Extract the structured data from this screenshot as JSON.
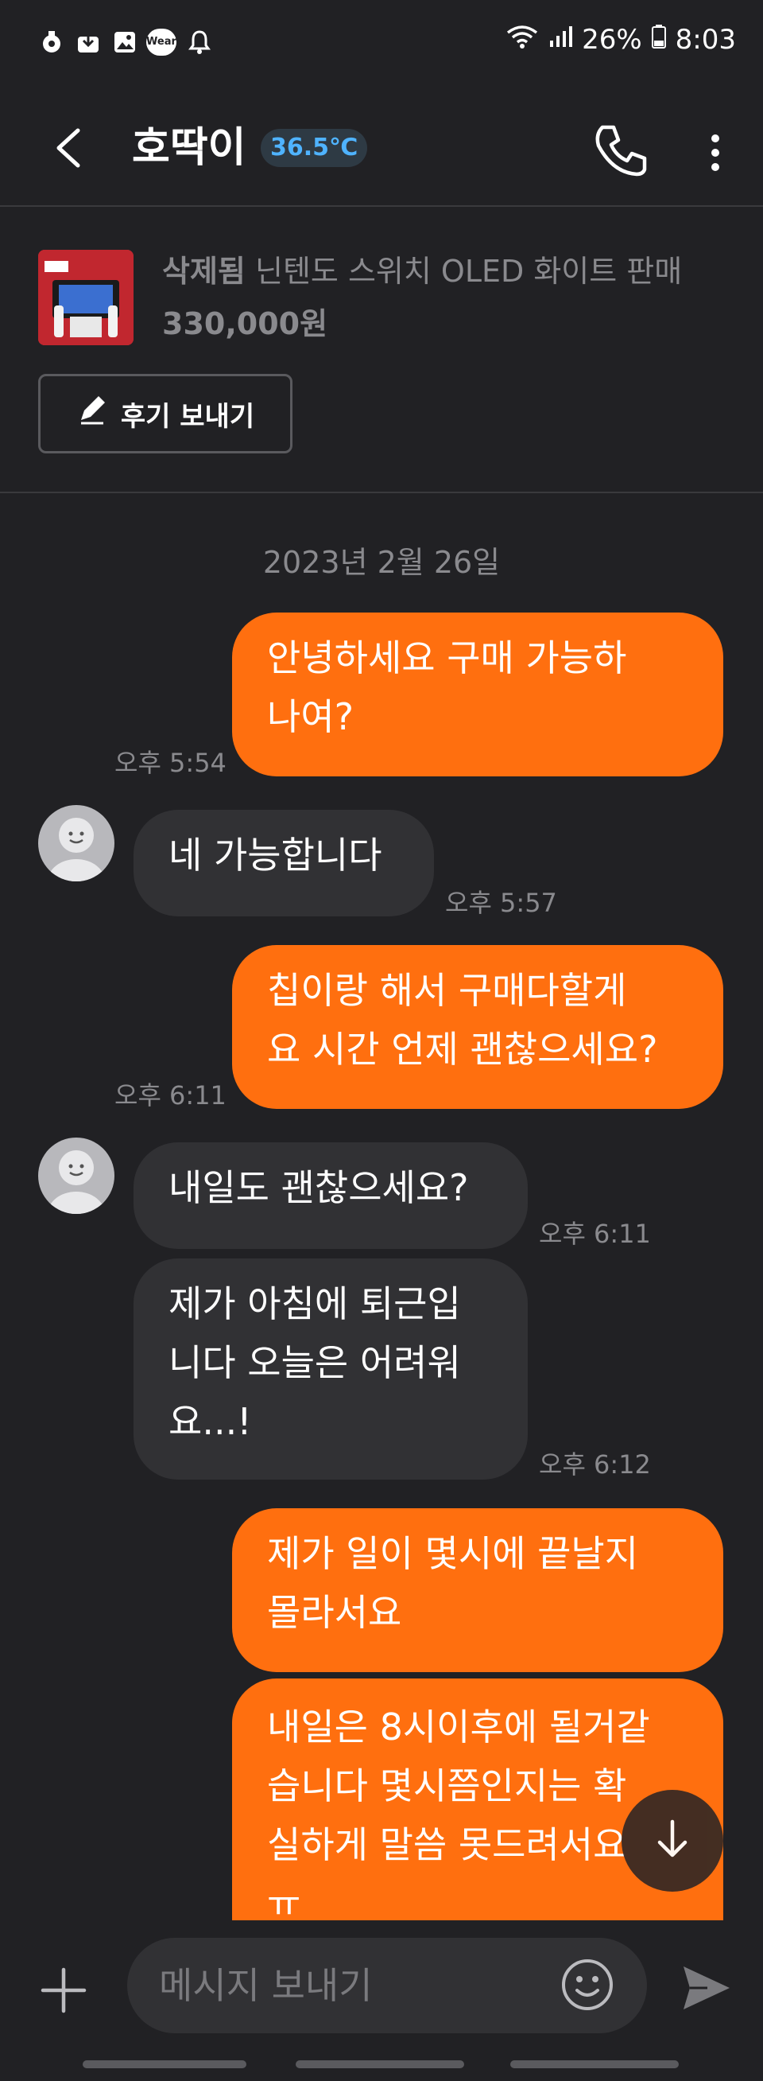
{
  "status_bar": {
    "icons": [
      "shield-icon",
      "download-icon",
      "image-icon",
      "wear-icon",
      "bell-icon"
    ],
    "wear_label": "Wear",
    "battery": "26%",
    "time": "8:03"
  },
  "header": {
    "title": "호딱이",
    "manner_temp": "36.5℃"
  },
  "product": {
    "status": "삭제됨",
    "name": "닌텐도 스위치 OLED 화이트 판매",
    "price": "330,000원",
    "review_button": "후기 보내기"
  },
  "chat": {
    "date": "2023년 2월 26일",
    "messages": [
      {
        "side": "out",
        "lines": [
          "안녕하세요 구매 가능하",
          "나여?"
        ],
        "time": "오후 5:54"
      },
      {
        "side": "in",
        "lines": [
          "네 가능합니다"
        ],
        "time": "오후 5:57"
      },
      {
        "side": "out",
        "lines": [
          "칩이랑 해서 구매다할게",
          "요 시간 언제 괜찮으세요?"
        ],
        "time": "오후 6:11"
      },
      {
        "side": "in",
        "lines": [
          "내일도 괜찮으세요?"
        ],
        "time": "오후 6:11"
      },
      {
        "side": "in",
        "lines": [
          "제가 아침에 퇴근입",
          "니다 오늘은 어려워",
          "요...!"
        ],
        "time": "오후 6:12"
      },
      {
        "side": "out",
        "lines": [
          "제가 일이 몇시에 끝날지",
          "몰라서요"
        ],
        "time": ""
      },
      {
        "side": "out",
        "lines": [
          "내일은 8시이후에 될거같",
          "습니다 몇시쯤인지는 확",
          "실하게 말씀 못드려서요",
          "ㅠ"
        ],
        "time": ""
      }
    ]
  },
  "input": {
    "placeholder": "메시지 보내기"
  },
  "colors": {
    "accent": "#ff6f0f",
    "background": "#212124",
    "incoming_bubble": "#313134",
    "temp_color": "#4fb3ff"
  }
}
